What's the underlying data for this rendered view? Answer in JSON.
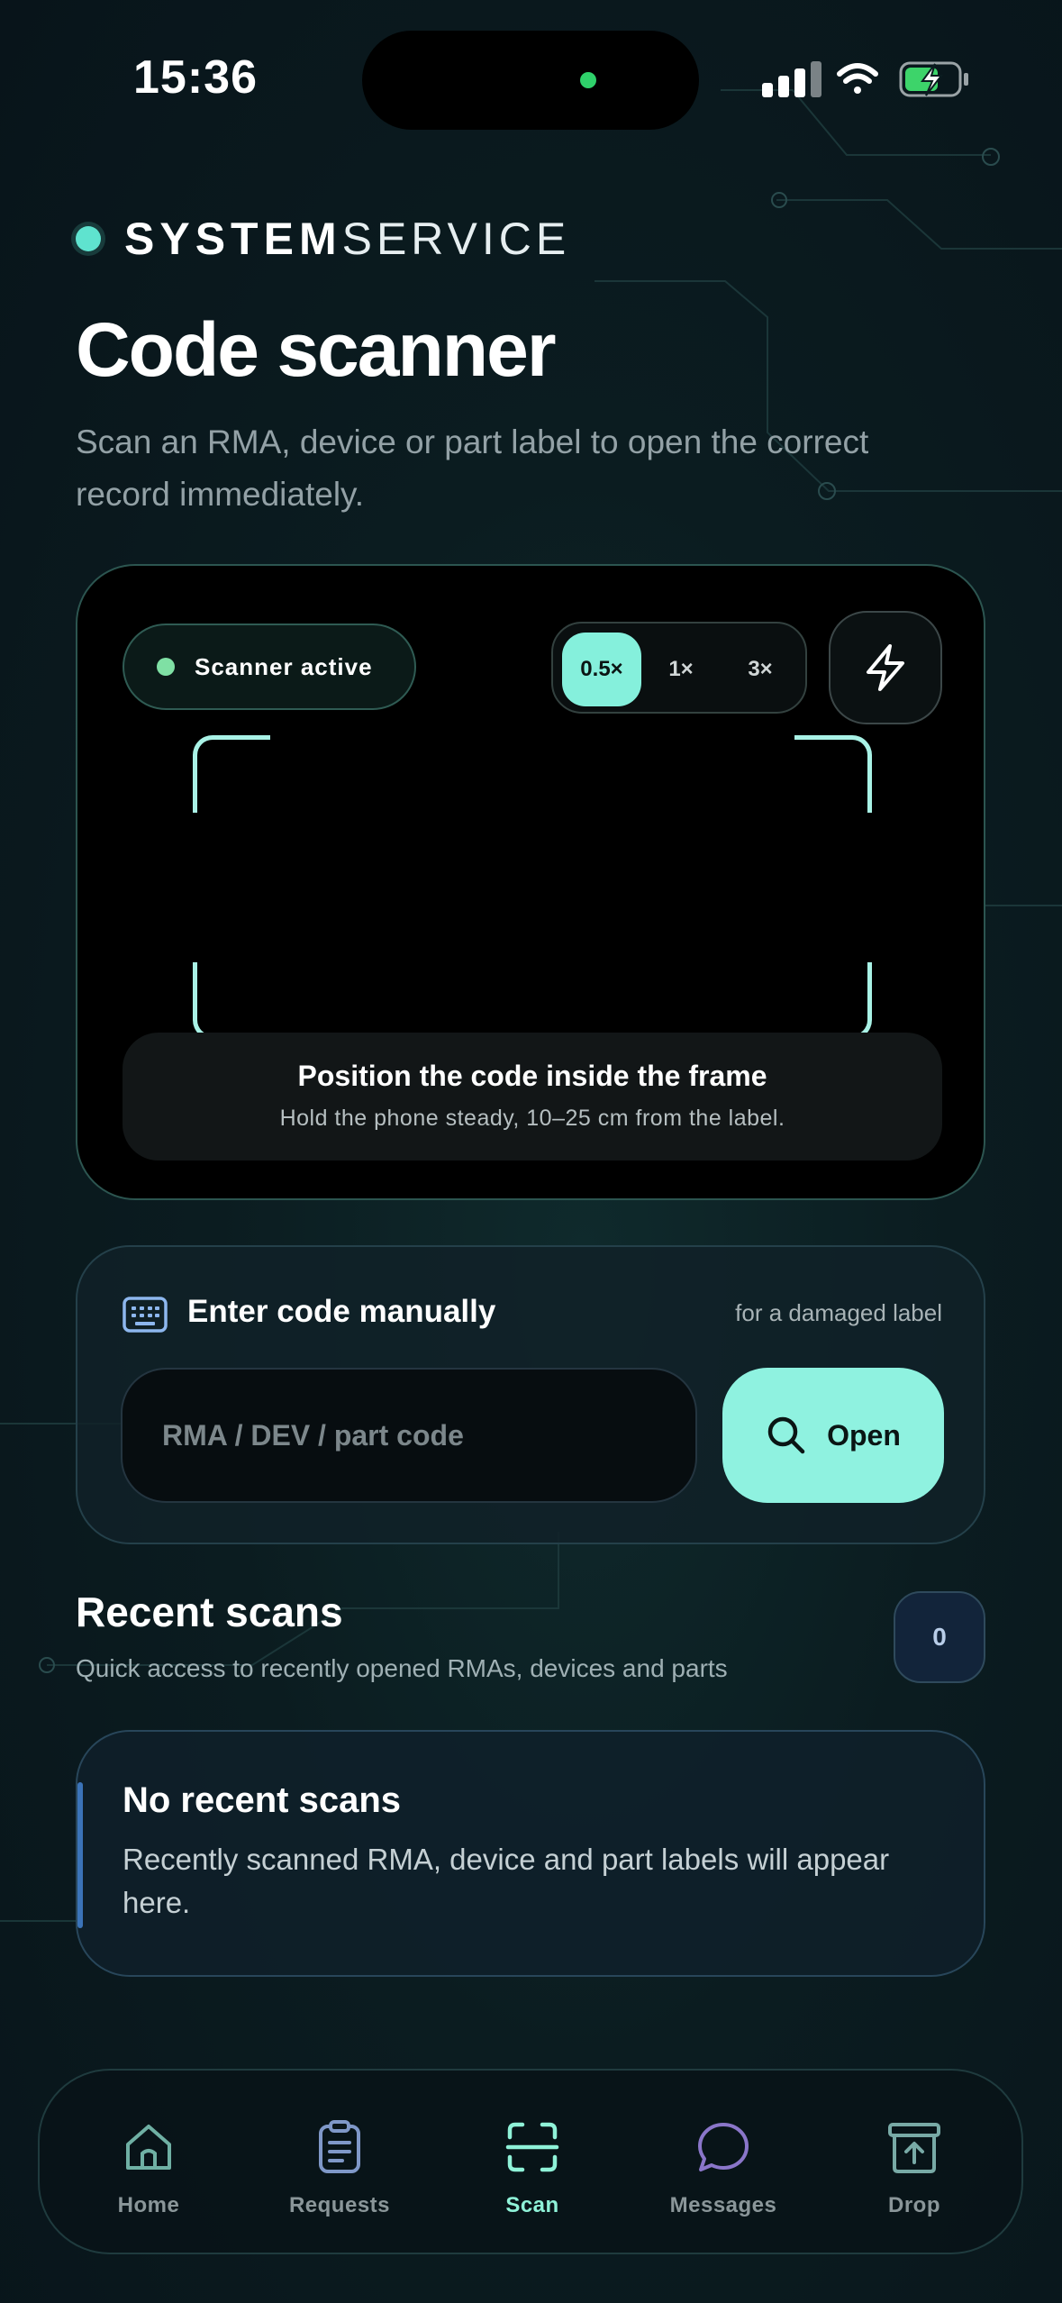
{
  "status_bar": {
    "time": "15:36"
  },
  "brand": {
    "strong": "SYSTEM",
    "light": "SERVICE"
  },
  "page": {
    "title": "Code scanner",
    "subtitle": "Scan an RMA, device or part label to open the correct record immediately."
  },
  "scanner": {
    "status_label": "Scanner active",
    "zoom_options": [
      "0.5×",
      "1×",
      "3×"
    ],
    "zoom_selected": "0.5×",
    "hint_title": "Position the code inside the frame",
    "hint_subtitle": "Hold the phone steady, 10–25 cm from the label."
  },
  "manual": {
    "title": "Enter code manually",
    "note": "for a damaged label",
    "placeholder": "RMA / DEV / part code",
    "value": "",
    "button_label": "Open"
  },
  "recent": {
    "title": "Recent scans",
    "subtitle": "Quick access to recently opened RMAs, devices and parts",
    "count": "0",
    "empty_title": "No recent scans",
    "empty_text": "Recently scanned RMA, device and part labels will appear here."
  },
  "tabs": [
    {
      "label": "Home",
      "icon": "home-icon"
    },
    {
      "label": "Requests",
      "icon": "clipboard-icon"
    },
    {
      "label": "Scan",
      "icon": "scan-icon"
    },
    {
      "label": "Messages",
      "icon": "chat-bubble-icon"
    },
    {
      "label": "Drop",
      "icon": "archive-upload-icon"
    }
  ],
  "active_tab": "Scan",
  "colors": {
    "accent": "#8ff2e0",
    "background": "#0b1c20",
    "scanner_corners": "#a9f2e6",
    "status_dot": "#7fe0a4"
  }
}
